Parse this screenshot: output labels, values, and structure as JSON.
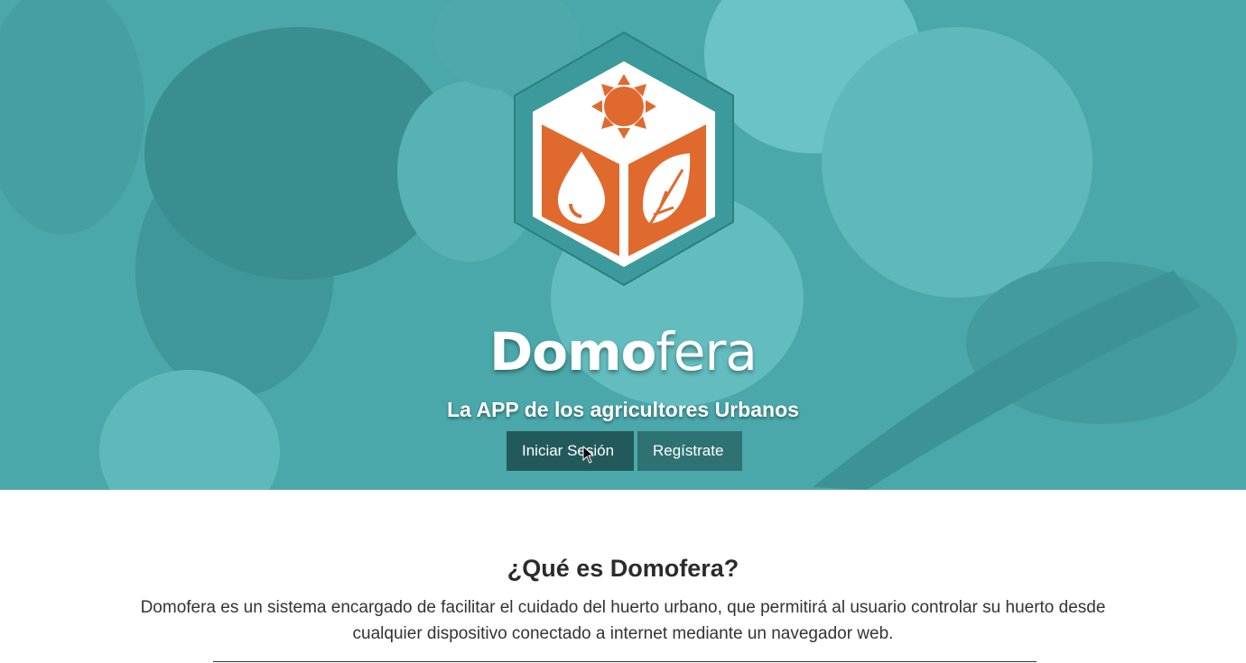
{
  "hero": {
    "brand_bold": "Domo",
    "brand_light": "fera",
    "tagline": "La APP de los agricultores Urbanos",
    "buttons": {
      "login": "Iniciar Sesión",
      "register": "Regístrate"
    },
    "colors": {
      "overlay": "#4aa8aa",
      "logo_orange": "#e06a2e",
      "logo_hex": "#3d9a9c"
    }
  },
  "about": {
    "title": "¿Qué es Domofera?",
    "description": "Domofera es un sistema encargado de facilitar el cuidado del huerto urbano, que permitirá al usuario controlar su huerto desde cualquier dispositivo conectado a internet mediante un navegador web."
  },
  "icons": {
    "logo": "domofera-cube-logo-icon",
    "sun": "sun-icon",
    "drop": "water-drop-icon",
    "leaf": "leaf-icon",
    "cursor": "mouse-pointer-icon"
  }
}
